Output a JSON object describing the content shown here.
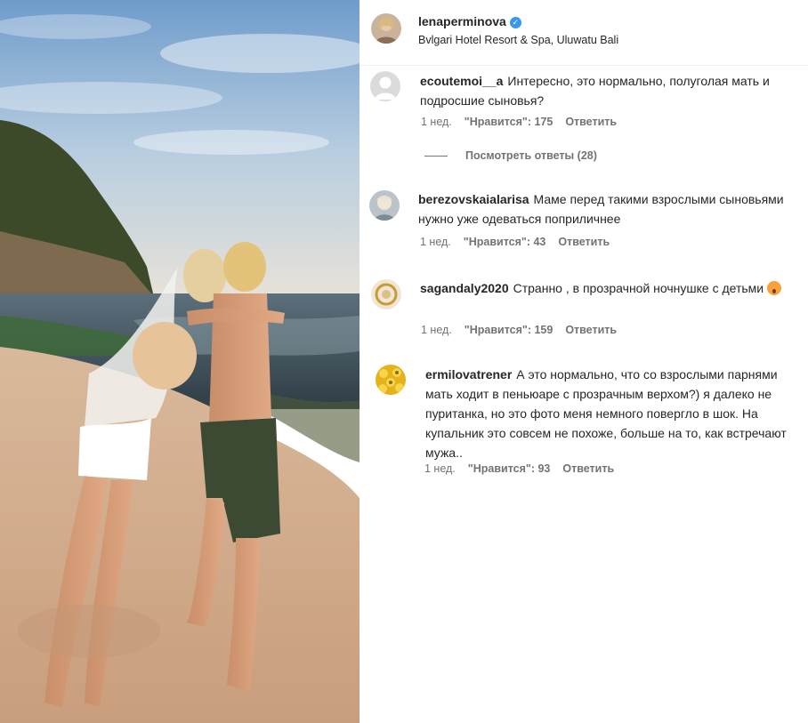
{
  "post": {
    "username": "lenaperminova",
    "location": "Bvlgari Hotel Resort & Spa, Uluwatu Bali",
    "verified_icon": "verified-badge-icon"
  },
  "comments": [
    {
      "username": "ecoutemoi__a",
      "text": "Интересно, это нормально, полуголая мать и подросшие сыновья?",
      "time": "1 нед.",
      "likes": "\"Нравится\": 175",
      "reply": "Ответить",
      "view_replies": "Посмотреть ответы (28)"
    },
    {
      "username": "berezovskaialarisa",
      "text": "Маме перед такими взрослыми сыновьями нужно уже одеваться поприличнее",
      "time": "1 нед.",
      "likes": "\"Нравится\": 43",
      "reply": "Ответить"
    },
    {
      "username": "sagandaly2020",
      "text": "Странно , в прозрачной ночнушке с детьми",
      "time": "1 нед.",
      "likes": "\"Нравится\": 159",
      "reply": "Ответить",
      "emoji": "astonished-face-emoji"
    },
    {
      "username": "ermilovatrener",
      "text": "А это нормально, что со взрослыми парнями мать ходит в пеньюаре с прозрачным верхом?) я далеко не пуританка, но это фото меня немного повергло в шок. На купальник это совсем не похоже, больше на то, как встречают мужа..",
      "time": "1 нед.",
      "likes": "\"Нравится\": 93",
      "reply": "Ответить"
    }
  ],
  "colors": {
    "verified": "#3897f0",
    "meta_text": "#737373",
    "main_text": "#262626"
  }
}
